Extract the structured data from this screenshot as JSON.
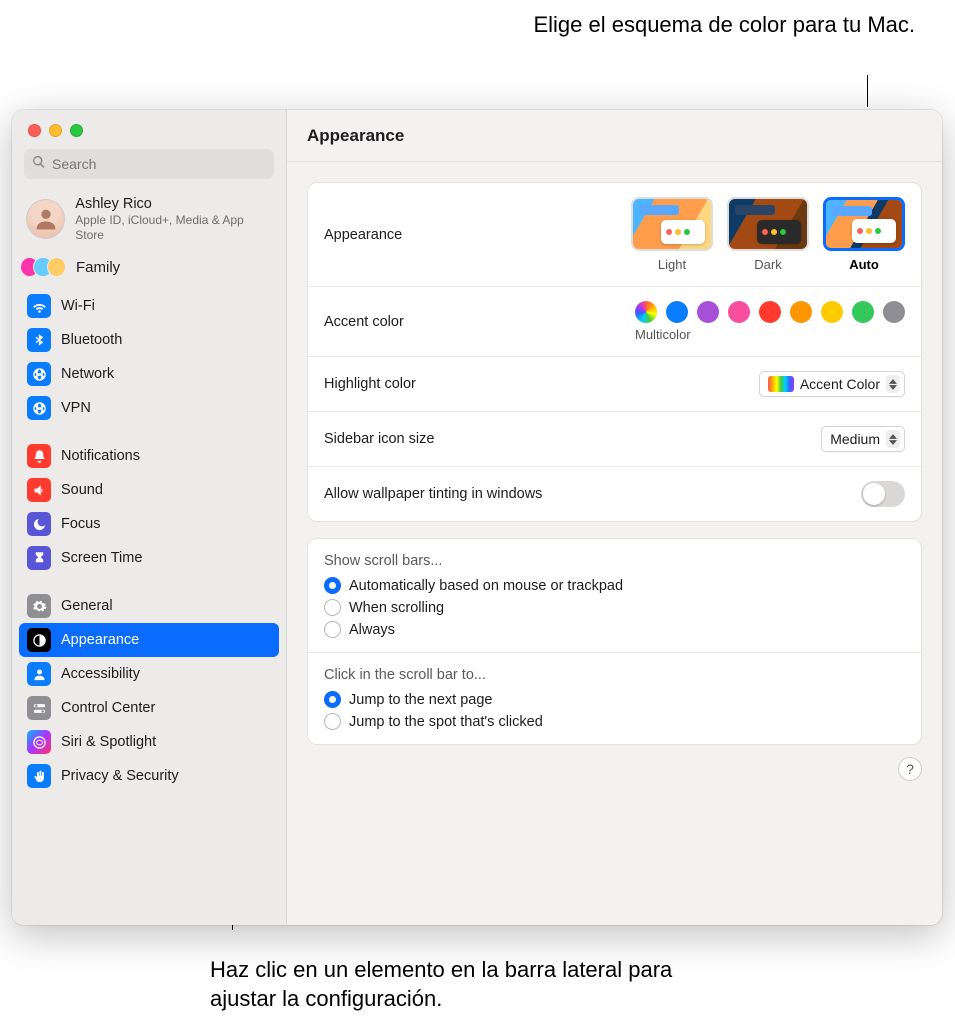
{
  "callouts": {
    "top": "Elige el esquema de color para tu Mac.",
    "bottom": "Haz clic en un elemento en la barra lateral para ajustar la configuración."
  },
  "search": {
    "placeholder": "Search"
  },
  "account": {
    "name": "Ashley Rico",
    "sub": "Apple ID, iCloud+, Media & App Store"
  },
  "family_label": "Family",
  "sidebar": {
    "groups": [
      [
        {
          "label": "Wi-Fi",
          "icon": "wifi",
          "color": "ic-blue"
        },
        {
          "label": "Bluetooth",
          "icon": "bluetooth",
          "color": "ic-blue"
        },
        {
          "label": "Network",
          "icon": "globe",
          "color": "ic-blue"
        },
        {
          "label": "VPN",
          "icon": "globe",
          "color": "ic-blue"
        }
      ],
      [
        {
          "label": "Notifications",
          "icon": "bell",
          "color": "ic-red"
        },
        {
          "label": "Sound",
          "icon": "speaker",
          "color": "ic-red"
        },
        {
          "label": "Focus",
          "icon": "moon",
          "color": "ic-indigo"
        },
        {
          "label": "Screen Time",
          "icon": "hourglass",
          "color": "ic-indigo"
        }
      ],
      [
        {
          "label": "General",
          "icon": "gear",
          "color": "ic-gray"
        },
        {
          "label": "Appearance",
          "icon": "contrast",
          "color": "ic-black",
          "selected": true
        },
        {
          "label": "Accessibility",
          "icon": "person",
          "color": "ic-blue"
        },
        {
          "label": "Control Center",
          "icon": "switches",
          "color": "ic-gray"
        },
        {
          "label": "Siri & Spotlight",
          "icon": "siri",
          "color": "ic-siri"
        },
        {
          "label": "Privacy & Security",
          "icon": "hand",
          "color": "ic-priv"
        }
      ]
    ]
  },
  "page_title": "Appearance",
  "appearance": {
    "row_label": "Appearance",
    "options": [
      {
        "label": "Light",
        "key": "light"
      },
      {
        "label": "Dark",
        "key": "dark"
      },
      {
        "label": "Auto",
        "key": "auto",
        "selected": true
      }
    ]
  },
  "accent": {
    "row_label": "Accent color",
    "colors": [
      "multicolor",
      "blue",
      "purple",
      "pink",
      "red",
      "orange",
      "yellow",
      "green",
      "gray"
    ],
    "selected_label": "Multicolor"
  },
  "highlight": {
    "row_label": "Highlight color",
    "value": "Accent Color"
  },
  "sidebar_size": {
    "row_label": "Sidebar icon size",
    "value": "Medium"
  },
  "tinting": {
    "row_label": "Allow wallpaper tinting in windows",
    "on": false
  },
  "scrollbars": {
    "heading": "Show scroll bars...",
    "options": [
      {
        "label": "Automatically based on mouse or trackpad",
        "selected": true
      },
      {
        "label": "When scrolling"
      },
      {
        "label": "Always"
      }
    ]
  },
  "scrollclick": {
    "heading": "Click in the scroll bar to...",
    "options": [
      {
        "label": "Jump to the next page",
        "selected": true
      },
      {
        "label": "Jump to the spot that's clicked"
      }
    ]
  },
  "help": "?"
}
